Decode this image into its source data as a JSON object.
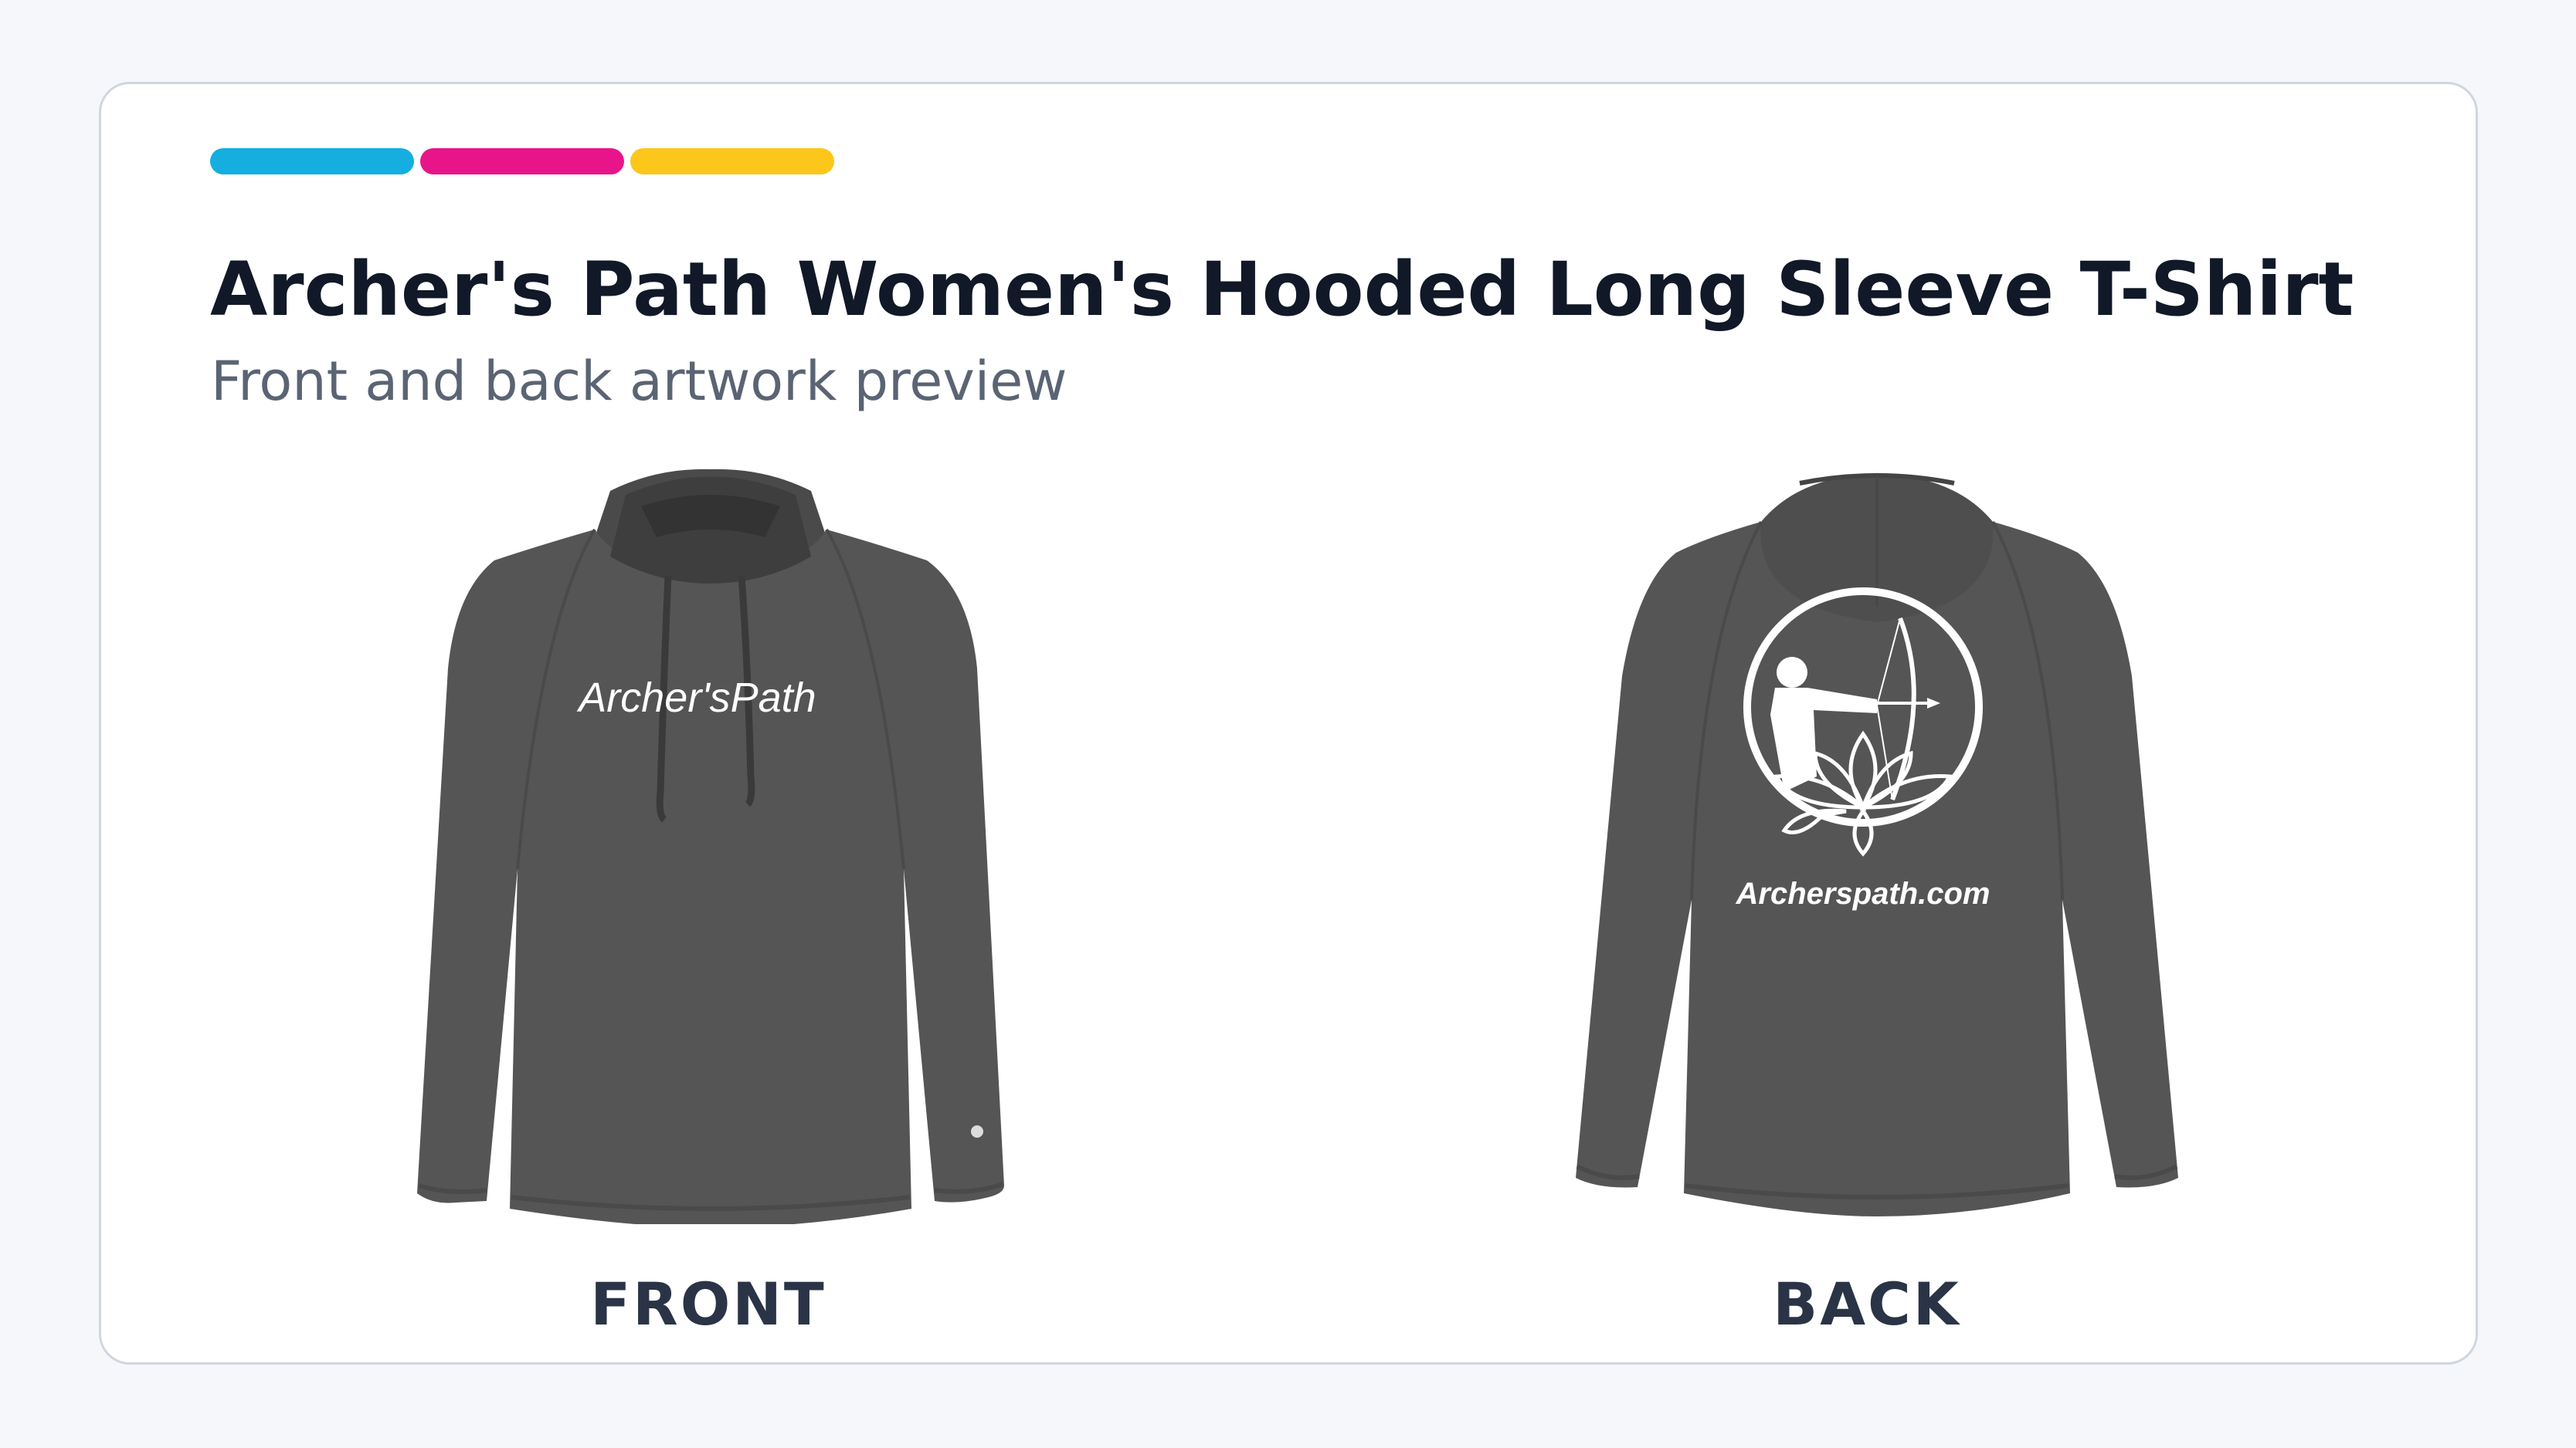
{
  "title": "Archer's Path Women's Hooded Long Sleeve T-Shirt",
  "subtitle": "Front and back artwork preview",
  "accent_colors": [
    "#14aee0",
    "#e8158a",
    "#fcc61a"
  ],
  "garment_color": "#555555",
  "front": {
    "caption": "FRONT",
    "print_text": "Archer'sPath"
  },
  "back": {
    "caption": "BACK",
    "print_text": "Archerspath.com",
    "logo_icon": "archer-lotus-logo-icon"
  }
}
